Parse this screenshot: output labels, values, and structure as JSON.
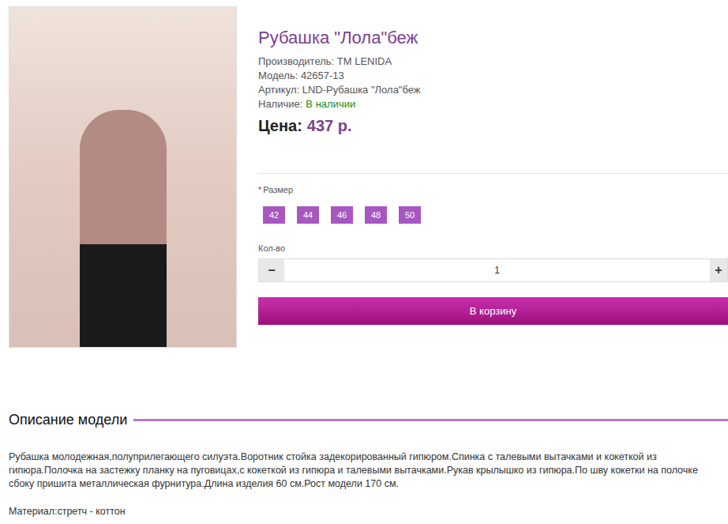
{
  "product": {
    "title": "Рубашка \"Лола\"беж",
    "info": [
      "Производитель: TM LENIDA",
      "Модель: 42657-13",
      "Артикул: LND-Рубашка \"Лола\"беж"
    ],
    "availability": {
      "label": "Наличие:",
      "value": "В наличии"
    },
    "price": {
      "label": "Цена:",
      "value": "437 р."
    }
  },
  "options": {
    "required_mark": "*",
    "size_label": "Размер",
    "sizes": [
      "42",
      "44",
      "46",
      "48",
      "50"
    ]
  },
  "quantity": {
    "label": "Кол-во",
    "value": "1",
    "minus": "−",
    "plus": "+"
  },
  "cart_button": "В корзину",
  "description": {
    "heading": "Описание модели",
    "text": "Рубашка молодежная,полуприлегающего силуэта.Воротник стойка задекорированный гипюром.Спинка с талевыми вытачками и кокеткой из гипюра.Полочка на застежку планку на пуговицах,с кокеткой из гипюра и талевыми вытачками.Рукав крылышко из гипюра.По шву кокетки на полочке сбоку пришита металлическая фурнитура.Длина изделия 60 см.Рост модели 170 см.",
    "material": "Материал:стретч - коттон"
  }
}
